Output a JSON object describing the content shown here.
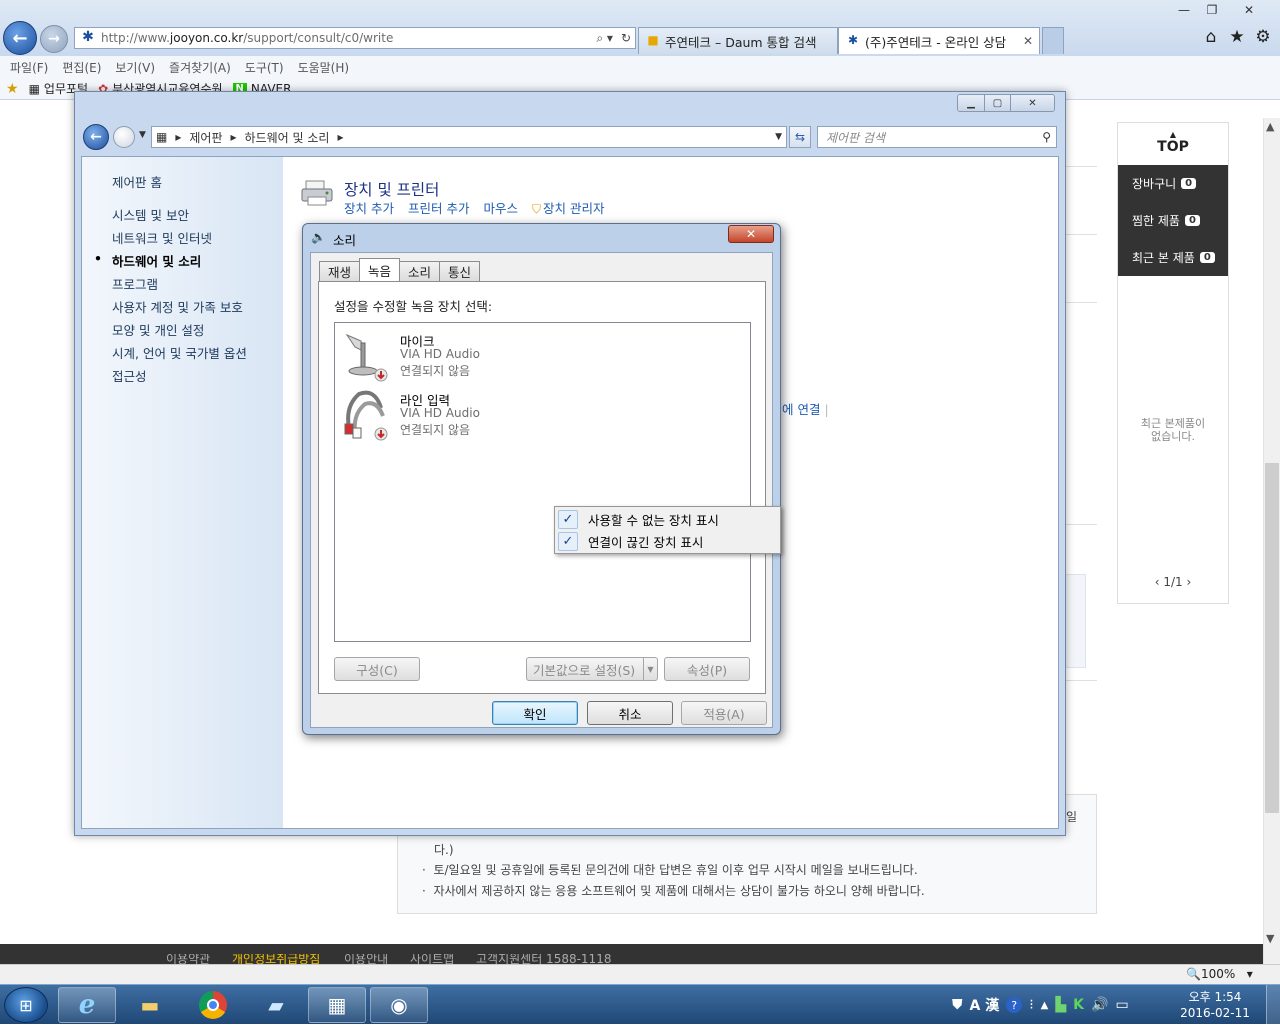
{
  "ie": {
    "url_prefix": "http://www.",
    "url_domain": "jooyon.co.kr",
    "url_path": "/support/consult/c0/write",
    "tabs": [
      {
        "label": "주연테크 – Daum 통합 검색"
      },
      {
        "label": "(주)주연테크 - 온라인 상담"
      }
    ],
    "menu": [
      "파일(F)",
      "편집(E)",
      "보기(V)",
      "즐겨찾기(A)",
      "도구(T)",
      "도움말(H)"
    ],
    "favorites": [
      "업무포털",
      "부산광역시교육연수원",
      "NAVER"
    ],
    "zoom": "100%"
  },
  "page": {
    "side_top": "TOP",
    "quick": [
      {
        "label": "장바구니",
        "count": "0"
      },
      {
        "label": "찜한 제품",
        "count": "0"
      },
      {
        "label": "최근 본 제품",
        "count": "0"
      }
    ],
    "recent_none_1": "최근 본제품이",
    "recent_none_2": "없습니다.",
    "pager": "1/1",
    "notice": [
      "다.)",
      "토/일요일 및 공휴일에 등록된 문의건에 대한 답변은 휴일 이후 업무 시작시 메일을 보내드립니다.",
      "자사에서 제공하지 않는 응용 소프트웨어 및 제품에 대해서는 상담이 불가능 하오니 양해 바랍니다."
    ],
    "notice_partial": "일",
    "footer": [
      "이용약관",
      "개인정보취급방침",
      "이용안내",
      "사이트맵",
      "고객지원센터 1588-1118"
    ]
  },
  "control_panel": {
    "breadcrumb": [
      "제어판",
      "하드웨어 및 소리"
    ],
    "search_placeholder": "제어판 검색",
    "left_links": [
      "제어판 홈",
      "시스템 및 보안",
      "네트워크 및 인터넷",
      "하드웨어 및 소리",
      "프로그램",
      "사용자 계정 및 가족 보호",
      "모양 및 개인 설정",
      "시계, 언어 및 국가별 옵션",
      "접근성"
    ],
    "section_title": "장치 및 프린터",
    "section_links": [
      "장치 추가",
      "프린터 추가",
      "마우스",
      "장치 관리자"
    ],
    "partial_link": "에 연결"
  },
  "sound_dialog": {
    "title": "소리",
    "tabs": [
      "재생",
      "녹음",
      "소리",
      "통신"
    ],
    "selected_tab": "녹음",
    "prompt": "설정을 수정할 녹음 장치 선택:",
    "devices": [
      {
        "name": "마이크",
        "driver": "VIA HD Audio",
        "status": "연결되지 않음",
        "icon": "microphone-icon"
      },
      {
        "name": "라인 입력",
        "driver": "VIA HD Audio",
        "status": "연결되지 않음",
        "icon": "line-in-icon"
      }
    ],
    "buttons": {
      "configure": "구성(C)",
      "set_default": "기본값으로 설정(S)",
      "properties": "속성(P)",
      "ok": "확인",
      "cancel": "취소",
      "apply": "적용(A)"
    }
  },
  "context_menu": {
    "items": [
      {
        "label": "사용할 수 없는 장치 표시",
        "checked": true
      },
      {
        "label": "연결이 끊긴 장치 표시",
        "checked": true
      }
    ]
  },
  "taskbar": {
    "time": "오후 1:54",
    "date": "2016-02-11",
    "ime": "A 漢"
  }
}
